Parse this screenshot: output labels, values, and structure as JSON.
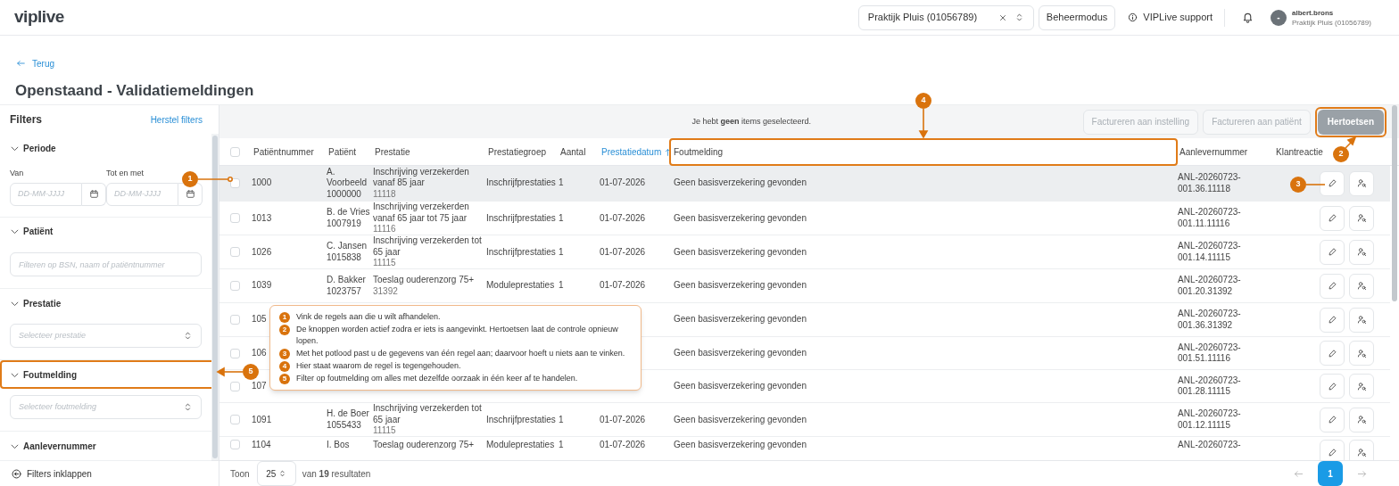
{
  "header": {
    "logo": "viplive",
    "practice_select": "Praktijk Pluis (01056789)",
    "admin_button": "Beheermodus",
    "support_link": "VIPLive support",
    "user": {
      "avatar": "-",
      "name": "albert.brons",
      "practice": "Praktijk Pluis (01056789)"
    }
  },
  "page": {
    "back_link": "Terug",
    "title": "Openstaand - Validatiemeldingen"
  },
  "filters": {
    "title": "Filters",
    "reset": "Herstel filters",
    "collapse": "Filters inklappen",
    "sections": [
      {
        "label": "Periode",
        "kind": "daterange",
        "highlighted": false,
        "fields": [
          {
            "label": "Van",
            "placeholder": "DD-MM-JJJJ"
          },
          {
            "label": "Tot en met",
            "placeholder": "DD-MM-JJJJ"
          }
        ]
      },
      {
        "label": "Patiënt",
        "kind": "text",
        "highlighted": false,
        "placeholder": "Filteren op BSN, naam of patiëntnummer"
      },
      {
        "label": "Prestatie",
        "kind": "select",
        "highlighted": false,
        "placeholder": "Selecteer prestatie"
      },
      {
        "label": "Foutmelding",
        "kind": "select",
        "highlighted": true,
        "placeholder": "Selecteer foutmelding"
      },
      {
        "label": "Aanlevernummer",
        "kind": "label",
        "highlighted": false
      }
    ]
  },
  "toolbar": {
    "message": "Je hebt **geen** items geselecteerd.",
    "buttons": [
      {
        "label": "Factureren aan instelling",
        "kind": "secondary",
        "disabled": true,
        "highlighted": false
      },
      {
        "label": "Factureren aan patiënt",
        "kind": "secondary",
        "disabled": true,
        "highlighted": false
      },
      {
        "label": "Hertoetsen",
        "kind": "primary",
        "disabled": true,
        "highlighted": true
      }
    ]
  },
  "table": {
    "select_all_checked": false,
    "columns": [
      {
        "label": "Patiëntnummer",
        "sorted": false,
        "highlighted": false
      },
      {
        "label": "Patiënt",
        "sorted": false,
        "highlighted": false
      },
      {
        "label": "Prestatie",
        "sorted": false,
        "highlighted": false
      },
      {
        "label": "Prestatiegroep",
        "sorted": false,
        "highlighted": false
      },
      {
        "label": "Aantal",
        "sorted": false,
        "highlighted": false
      },
      {
        "label": "Prestatiedatum",
        "sorted": true,
        "highlighted": false
      },
      {
        "label": "Foutmelding",
        "sorted": false,
        "highlighted": true
      },
      {
        "label": "Aanlevernummer",
        "sorted": false,
        "highlighted": false
      },
      {
        "label": "Klantreactie",
        "sorted": false,
        "highlighted": false
      }
    ],
    "rows": [
      {
        "checked": false,
        "hovered": true,
        "number": "1000",
        "patient": "A. Voorbeeld",
        "patient_id": "1000000",
        "service": "Inschrijving verzekerden vanaf 85 jaar",
        "service_code": "11118",
        "group": "Inschrijfprestaties",
        "count": "1",
        "date": "01-07-2026",
        "error": "Geen basisverzekering gevonden",
        "delivery": [
          "ANL-20260723-",
          "001.36.11118"
        ]
      },
      {
        "checked": false,
        "hovered": false,
        "number": "1013",
        "patient": "B. de Vries",
        "patient_id": "1007919",
        "service": "Inschrijving verzekerden vanaf 65 jaar tot 75 jaar",
        "service_code": "11116",
        "group": "Inschrijfprestaties",
        "count": "1",
        "date": "01-07-2026",
        "error": "Geen basisverzekering gevonden",
        "delivery": [
          "ANL-20260723-",
          "001.11.11116"
        ]
      },
      {
        "checked": false,
        "hovered": false,
        "number": "1026",
        "patient": "C. Jansen",
        "patient_id": "1015838",
        "service": "Inschrijving verzekerden tot 65 jaar",
        "service_code": "11115",
        "group": "Inschrijfprestaties",
        "count": "1",
        "date": "01-07-2026",
        "error": "Geen basisverzekering gevonden",
        "delivery": [
          "ANL-20260723-",
          "001.14.11115"
        ]
      },
      {
        "checked": false,
        "hovered": false,
        "number": "1039",
        "patient": "D. Bakker",
        "patient_id": "1023757",
        "service": "Toeslag ouderenzorg 75+",
        "service_code": "31392",
        "group": "Moduleprestaties",
        "count": "1",
        "date": "01-07-2026",
        "error": "Geen basisverzekering gevonden",
        "delivery": [
          "ANL-20260723-",
          "001.20.31392"
        ]
      },
      {
        "checked": false,
        "hovered": false,
        "number": "105",
        "error": "Geen basisverzekering gevonden",
        "delivery": [
          "ANL-20260723-",
          "001.36.31392"
        ]
      },
      {
        "checked": false,
        "hovered": false,
        "number": "106",
        "error": "Geen basisverzekering gevonden",
        "delivery": [
          "ANL-20260723-",
          "001.51.11116"
        ]
      },
      {
        "checked": false,
        "hovered": false,
        "number": "107",
        "error": "Geen basisverzekering gevonden",
        "delivery": [
          "ANL-20260723-",
          "001.28.11115"
        ]
      },
      {
        "checked": false,
        "hovered": false,
        "number": "1091",
        "patient": "H. de Boer",
        "patient_id": "1055433",
        "service": "Inschrijving verzekerden tot 65 jaar",
        "service_code": "11115",
        "group": "Inschrijfprestaties",
        "count": "1",
        "date": "01-07-2026",
        "error": "Geen basisverzekering gevonden",
        "delivery": [
          "ANL-20260723-",
          "001.12.11115"
        ]
      },
      {
        "checked": false,
        "hovered": false,
        "number": "1104",
        "patient": "I. Bos",
        "service": "Toeslag ouderenzorg 75+",
        "group": "Moduleprestaties",
        "count": "1",
        "date": "01-07-2026",
        "error": "Geen basisverzekering gevonden",
        "delivery": [
          "ANL-20260723-"
        ]
      }
    ]
  },
  "pagination": {
    "show_label": "Toon",
    "page_size": "25",
    "results": "van **19** resultaten",
    "pages": [
      {
        "label": "1",
        "selected": true
      }
    ]
  },
  "callouts": [
    {
      "number": "1"
    },
    {
      "number": "2"
    },
    {
      "number": "3"
    },
    {
      "number": "4"
    },
    {
      "number": "5"
    }
  ],
  "legend": [
    {
      "number": "1",
      "text": "Vink de regels aan die u wilt afhandelen."
    },
    {
      "number": "2",
      "text": "De knoppen worden actief zodra er iets is aangevinkt. Hertoetsen laat de controle opnieuw lopen."
    },
    {
      "number": "3",
      "text": "Met het potlood past u de gegevens van één regel aan; daarvoor hoeft u niets aan te vinken."
    },
    {
      "number": "4",
      "text": "Hier staat waarom de regel is tegengehouden."
    },
    {
      "number": "5",
      "text": "Filter op foutmelding om alles met dezelfde oorzaak in één keer af te handelen."
    }
  ]
}
